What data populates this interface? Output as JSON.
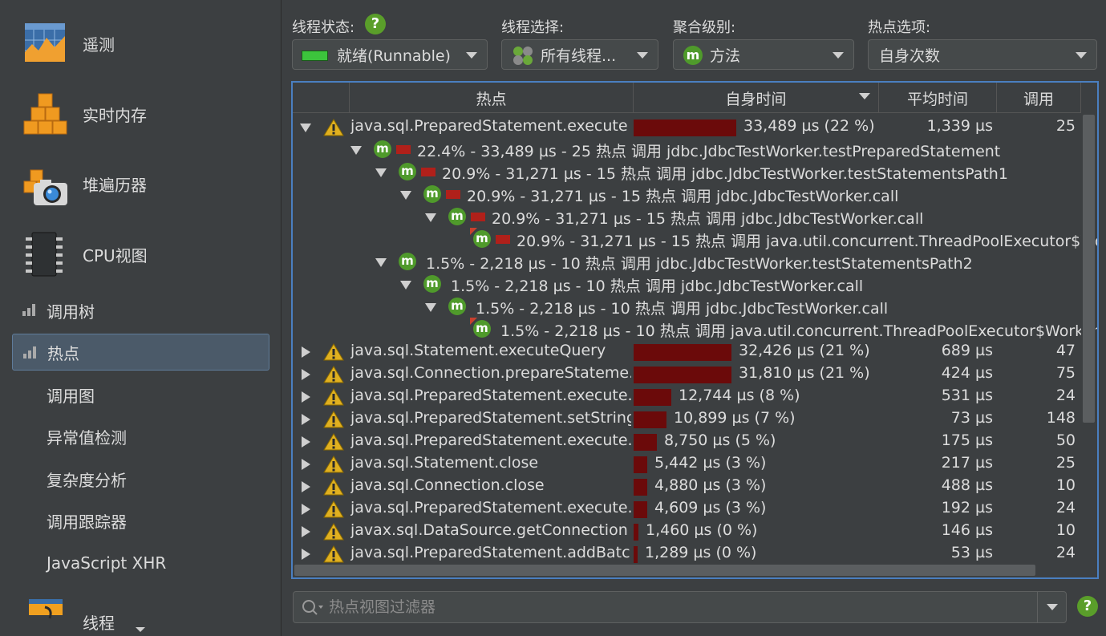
{
  "sidebar": {
    "big_items": [
      {
        "label": "遥测",
        "icon": "telemetry-icon"
      },
      {
        "label": "实时内存",
        "icon": "live-memory-icon"
      },
      {
        "label": "堆遍历器",
        "icon": "heap-walker-icon"
      },
      {
        "label": "CPU视图",
        "icon": "cpu-chip-icon"
      }
    ],
    "sub_items": [
      {
        "label": "调用树",
        "icon": "bar-chart-icon"
      },
      {
        "label": "热点",
        "icon": "bar-chart-icon",
        "selected": true
      },
      {
        "label": "调用图"
      },
      {
        "label": "异常值检测"
      },
      {
        "label": "复杂度分析"
      },
      {
        "label": "调用跟踪器"
      },
      {
        "label": "JavaScript XHR"
      }
    ],
    "bottom_item": {
      "label": "线程",
      "icon": "threads-icon"
    }
  },
  "controls": {
    "thread_state": {
      "label": "线程状态:",
      "value": "就绪(Runnable)",
      "indicator_color": "#3cc43c"
    },
    "thread_select": {
      "label": "线程选择:",
      "value": "所有线程..."
    },
    "aggregation": {
      "label": "聚合级别:",
      "value": "方法"
    },
    "hotspot_options": {
      "label": "热点选项:",
      "value": "自身次数"
    }
  },
  "table": {
    "columns": [
      "热点",
      "自身时间",
      "平均时间",
      "调用"
    ],
    "rows": [
      {
        "kind": "top",
        "expanded": true,
        "name": "java.sql.PreparedStatement.execute",
        "self_time": "33,489 µs (22 %)",
        "pct": 22,
        "avg": "1,339 µs",
        "calls": "25"
      },
      {
        "kind": "child",
        "depth": 1,
        "expanded": true,
        "bar": true,
        "text": "22.4% - 33,489 µs - 25 热点 调用 jdbc.JdbcTestWorker.testPreparedStatement"
      },
      {
        "kind": "child",
        "depth": 2,
        "expanded": true,
        "bar": true,
        "text": "20.9% - 31,271 µs - 15 热点 调用 jdbc.JdbcTestWorker.testStatementsPath1"
      },
      {
        "kind": "child",
        "depth": 3,
        "expanded": true,
        "bar": true,
        "text": "20.9% - 31,271 µs - 15 热点 调用 jdbc.JdbcTestWorker.call"
      },
      {
        "kind": "child",
        "depth": 4,
        "expanded": true,
        "bar": true,
        "text": "20.9% - 31,271 µs - 15 热点 调用 jdbc.JdbcTestWorker.call"
      },
      {
        "kind": "child",
        "depth": 5,
        "leaf": true,
        "bar": true,
        "text": "20.9% - 31,271 µs - 15 热点 调用 java.util.concurrent.ThreadPoolExecutor$Worke"
      },
      {
        "kind": "child",
        "depth": 2,
        "expanded": true,
        "bar": false,
        "text": "1.5% - 2,218 µs - 10 热点 调用 jdbc.JdbcTestWorker.testStatementsPath2"
      },
      {
        "kind": "child",
        "depth": 3,
        "expanded": true,
        "bar": false,
        "text": "1.5% - 2,218 µs - 10 热点 调用 jdbc.JdbcTestWorker.call"
      },
      {
        "kind": "child",
        "depth": 4,
        "expanded": true,
        "bar": false,
        "text": "1.5% - 2,218 µs - 10 热点 调用 jdbc.JdbcTestWorker.call"
      },
      {
        "kind": "child",
        "depth": 5,
        "leaf": true,
        "bar": false,
        "text": "1.5% - 2,218 µs - 10 热点 调用 java.util.concurrent.ThreadPoolExecutor$Worker.ru"
      },
      {
        "kind": "top",
        "expanded": false,
        "name": "java.sql.Statement.executeQuery",
        "self_time": "32,426 µs (21 %)",
        "pct": 21,
        "avg": "689 µs",
        "calls": "47"
      },
      {
        "kind": "top",
        "expanded": false,
        "name": "java.sql.Connection.prepareStateme...",
        "self_time": "31,810 µs (21 %)",
        "pct": 21,
        "avg": "424 µs",
        "calls": "75"
      },
      {
        "kind": "top",
        "expanded": false,
        "name": "java.sql.PreparedStatement.execute...",
        "self_time": "12,744 µs (8 %)",
        "pct": 8,
        "avg": "531 µs",
        "calls": "24"
      },
      {
        "kind": "top",
        "expanded": false,
        "name": "java.sql.PreparedStatement.setString",
        "self_time": "10,899 µs (7 %)",
        "pct": 7,
        "avg": "73 µs",
        "calls": "148"
      },
      {
        "kind": "top",
        "expanded": false,
        "name": "java.sql.PreparedStatement.execute...",
        "self_time": "8,750 µs (5 %)",
        "pct": 5,
        "avg": "175 µs",
        "calls": "50"
      },
      {
        "kind": "top",
        "expanded": false,
        "name": "java.sql.Statement.close",
        "self_time": "5,442 µs (3 %)",
        "pct": 3,
        "avg": "217 µs",
        "calls": "25"
      },
      {
        "kind": "top",
        "expanded": false,
        "name": "java.sql.Connection.close",
        "self_time": "4,880 µs (3 %)",
        "pct": 3,
        "avg": "488 µs",
        "calls": "10"
      },
      {
        "kind": "top",
        "expanded": false,
        "name": "java.sql.PreparedStatement.execute...",
        "self_time": "4,609 µs (3 %)",
        "pct": 3,
        "avg": "192 µs",
        "calls": "24"
      },
      {
        "kind": "top",
        "expanded": false,
        "name": "javax.sql.DataSource.getConnection",
        "self_time": "1,460 µs (0 %)",
        "pct": 0.96,
        "avg": "146 µs",
        "calls": "10"
      },
      {
        "kind": "top",
        "expanded": false,
        "name": "java.sql.PreparedStatement.addBatch",
        "self_time": "1,289 µs (0 %)",
        "pct": 0.85,
        "avg": "53 µs",
        "calls": "24"
      }
    ]
  },
  "filter": {
    "placeholder": "热点视图过滤器"
  },
  "colors": {
    "selection_border": "#4a7fc0",
    "time_bar": "#6b0a0a",
    "method_icon": "#4f9a2b",
    "warning": "#e0b020"
  }
}
